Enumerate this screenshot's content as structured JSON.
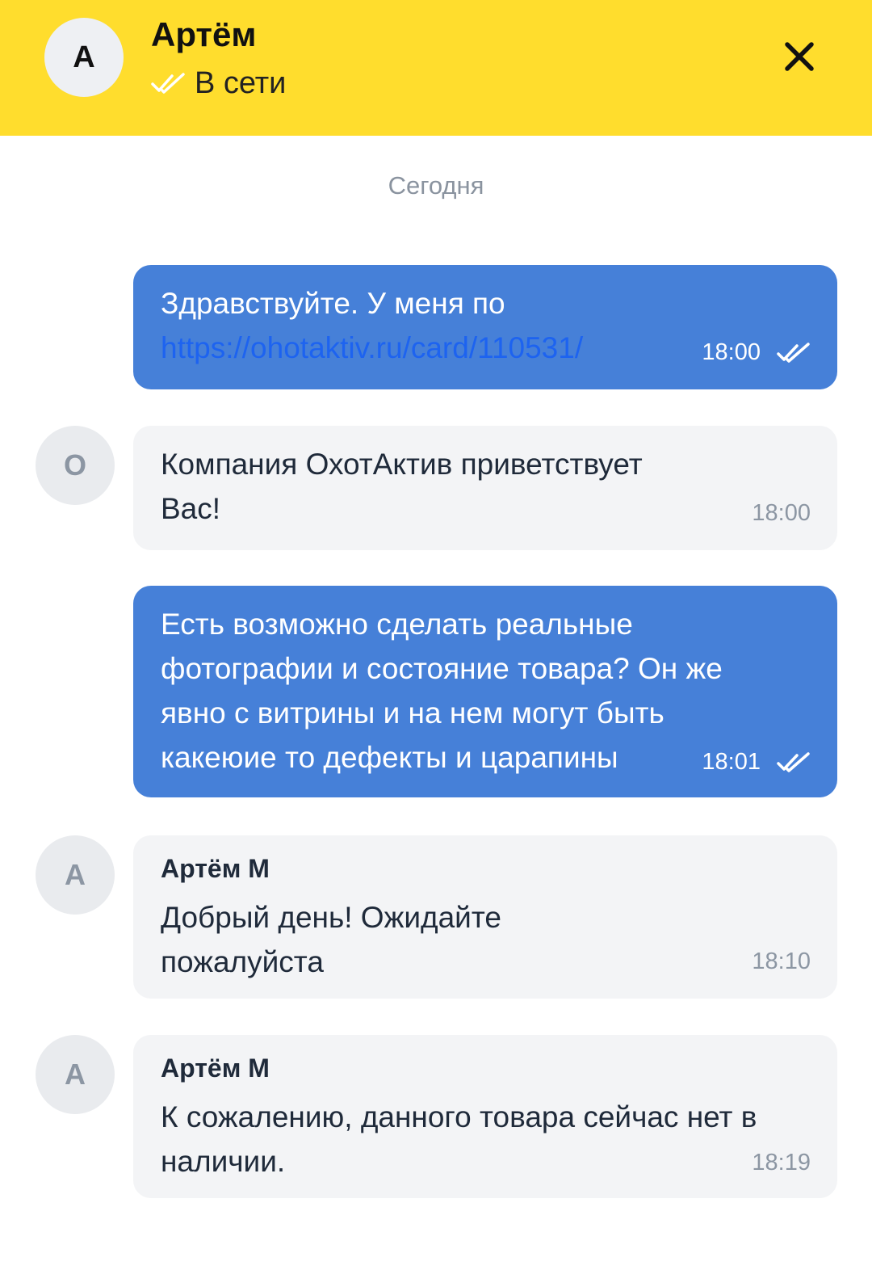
{
  "header": {
    "avatar_letter": "А",
    "name": "Артём",
    "status": "В сети",
    "colors": {
      "background": "#ffdd2d"
    }
  },
  "date_separator": "Сегодня",
  "messages": [
    {
      "direction": "out",
      "text": "Здравствуйте. У меня по",
      "link": "https://ohotaktiv.ru/card/110531/",
      "time": "18:00",
      "status_icon": "double-check-icon"
    },
    {
      "direction": "in",
      "avatar_letter": "О",
      "text": "Компания ОхотАктив приветствует Вас!",
      "time": "18:00"
    },
    {
      "direction": "out",
      "text": "Есть возможно сделать реальные фотографии и состояние товара? Он же явно с витрины и на нем могут быть какеюие то дефекты и царапины",
      "time": "18:01",
      "status_icon": "double-check-icon"
    },
    {
      "direction": "in",
      "avatar_letter": "А",
      "sender": "Артём М",
      "text": "Добрый день! Ожидайте пожалуйста",
      "time": "18:10"
    },
    {
      "direction": "in",
      "avatar_letter": "А",
      "sender": "Артём М",
      "text": "К сожалению, данного товара сейчас нет в наличии.",
      "time": "18:19"
    }
  ],
  "colors": {
    "outgoing_bubble": "#4680d8",
    "incoming_bubble": "#f3f4f6",
    "link": "#1d63f0"
  }
}
